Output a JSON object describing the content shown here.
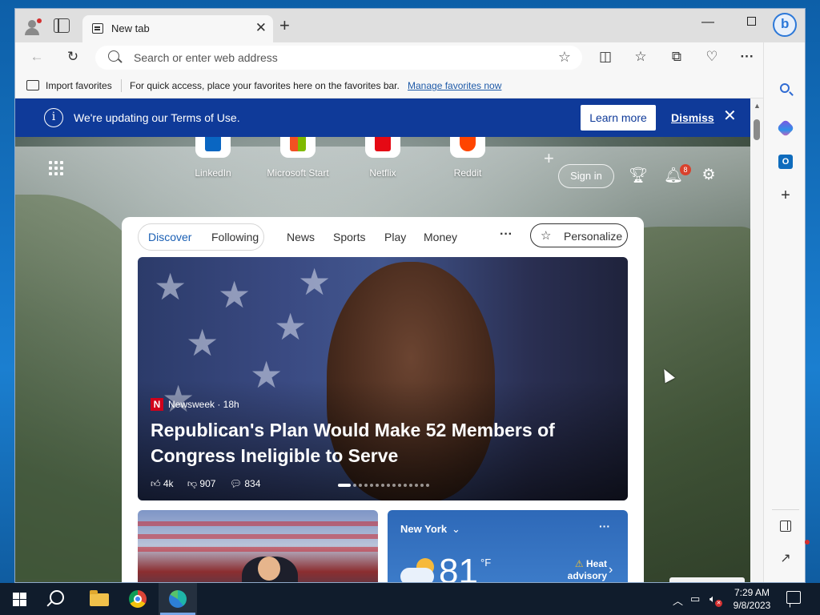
{
  "browser": {
    "tab_title": "New tab",
    "address_placeholder": "Search or enter web address",
    "favorites_bar": {
      "import_label": "Import favorites",
      "tip": "For quick access, place your favorites here on the favorites bar.",
      "manage_link": "Manage favorites now"
    }
  },
  "banner": {
    "text": "We're updating our Terms of Use.",
    "learn_more": "Learn more",
    "dismiss": "Dismiss"
  },
  "quick_links": [
    {
      "label": "LinkedIn",
      "icon": "linkedin-icon",
      "color": "#0a66c2"
    },
    {
      "label": "Microsoft Start",
      "icon": "microsoft-start-icon",
      "color": "#f25022"
    },
    {
      "label": "Netflix",
      "icon": "netflix-icon",
      "color": "#e50914"
    },
    {
      "label": "Reddit",
      "icon": "reddit-icon",
      "color": "#ff4500"
    }
  ],
  "top_controls": {
    "sign_in": "Sign in",
    "notification_count": "8"
  },
  "feed": {
    "tabs": [
      "Discover",
      "Following",
      "News",
      "Sports",
      "Play",
      "Money"
    ],
    "more": "···",
    "personalize": "Personalize",
    "hero": {
      "source": "Newsweek · 18h",
      "source_logo": "N",
      "headline": "Republican's Plan Would Make 52 Members of Congress Ineligible to Serve",
      "likes": "4k",
      "dislikes": "907",
      "comments": "834"
    },
    "weather": {
      "city": "New York",
      "temp": "81",
      "unit": "°F",
      "alert": "Heat advisory"
    }
  },
  "taskbar": {
    "time": "7:29 AM",
    "date": "9/8/2023"
  },
  "colors": {
    "banner_bg": "#0f3a99",
    "accent": "#1a5fb4",
    "taskbar_bg": "#101c2c"
  }
}
